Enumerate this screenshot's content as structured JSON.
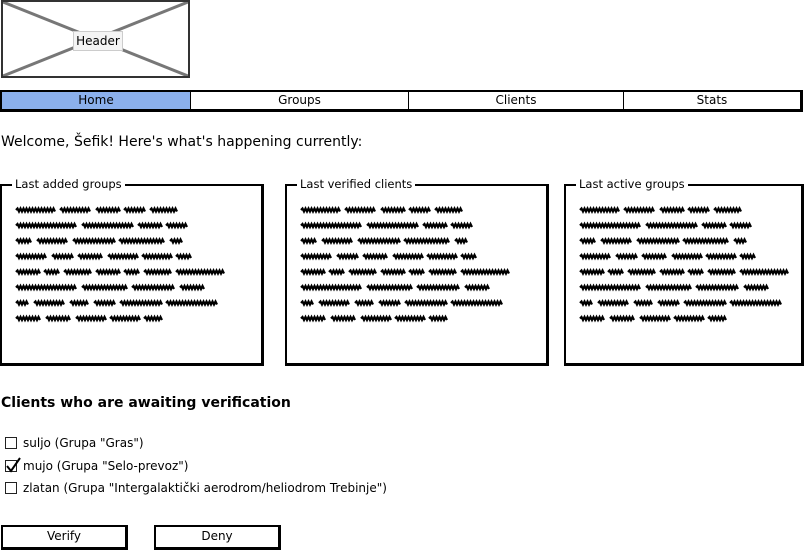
{
  "header": {
    "label": "Header"
  },
  "nav": {
    "tabs": [
      {
        "label": "Home",
        "active": true
      },
      {
        "label": "Groups",
        "active": false
      },
      {
        "label": "Clients",
        "active": false
      },
      {
        "label": "Stats",
        "active": false
      }
    ]
  },
  "welcome": "Welcome, Šefik! Here's what's happening currently:",
  "panels": [
    {
      "title": "Last added groups"
    },
    {
      "title": "Last verified clients"
    },
    {
      "title": "Last active groups"
    }
  ],
  "verification": {
    "title": "Clients who are awaiting verification",
    "clients": [
      {
        "label": "suljo (Grupa \"Gras\")",
        "checked": false
      },
      {
        "label": "mujo (Grupa \"Selo-prevoz\")",
        "checked": true
      },
      {
        "label": "zlatan (Grupa \"Intergalaktički aerodrom/heliodrom Trebinje\")",
        "checked": false
      }
    ]
  },
  "actions": {
    "verify_label": "Verify",
    "deny_label": "Deny"
  },
  "colors": {
    "active_tab": "#8bb0ec"
  }
}
